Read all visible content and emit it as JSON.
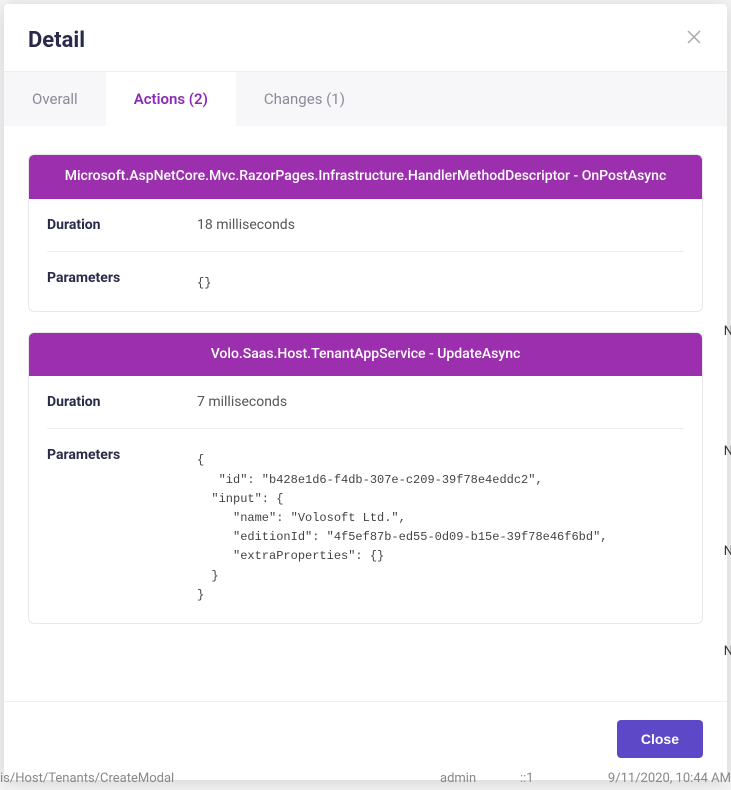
{
  "modal": {
    "title": "Detail",
    "closeButtonLabel": "Close"
  },
  "tabs": [
    {
      "label": "Overall",
      "count": ""
    },
    {
      "label": "Actions",
      "count": "(2)"
    },
    {
      "label": "Changes",
      "count": "(1)"
    }
  ],
  "actions": [
    {
      "title": "Microsoft.AspNetCore.Mvc.RazorPages.Infrastructure.HandlerMethodDescriptor - OnPostAsync",
      "durationLabel": "Duration",
      "duration": "18 milliseconds",
      "parametersLabel": "Parameters",
      "parameters": "{}"
    },
    {
      "title": "Volo.Saas.Host.TenantAppService - UpdateAsync",
      "durationLabel": "Duration",
      "duration": "7 milliseconds",
      "parametersLabel": "Parameters",
      "parameters": "{\n   \"id\": \"b428e1d6-f4db-307e-c209-39f78e4eddc2\",\n  \"input\": {\n     \"name\": \"Volosoft Ltd.\",\n     \"editionId\": \"4f5ef87b-ed55-0d09-b15e-39f78e46f6bd\",\n     \"extraProperties\": {}\n  }\n}"
    }
  ],
  "background": {
    "path": "is/Host/Tenants/CreateModal",
    "user": "admin",
    "spacer": "::1",
    "datetime": "9/11/2020, 10:44 AM",
    "sideN": "N"
  }
}
